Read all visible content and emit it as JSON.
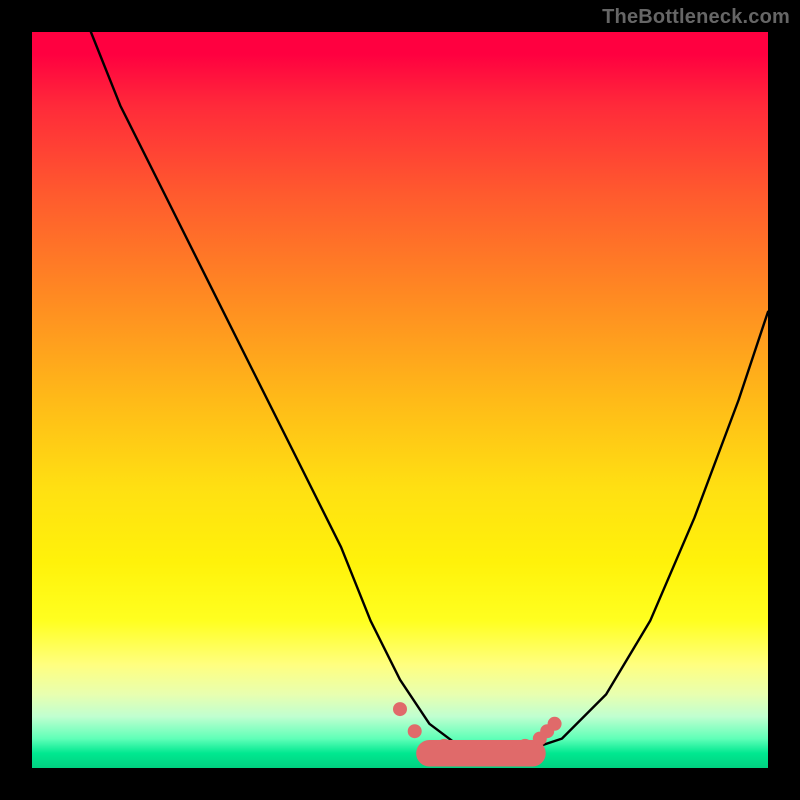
{
  "watermark": "TheBottleneck.com",
  "chart_data": {
    "type": "line",
    "title": "",
    "xlabel": "",
    "ylabel": "",
    "xlim": [
      0,
      100
    ],
    "ylim": [
      0,
      100
    ],
    "series": [
      {
        "name": "bottleneck-curve",
        "x": [
          8,
          12,
          18,
          24,
          30,
          36,
          42,
          46,
          50,
          54,
          58,
          62,
          66,
          72,
          78,
          84,
          90,
          96,
          100
        ],
        "values": [
          100,
          90,
          78,
          66,
          54,
          42,
          30,
          20,
          12,
          6,
          3,
          2,
          2,
          4,
          10,
          20,
          34,
          50,
          62
        ]
      }
    ],
    "markers": {
      "name": "highlight-dots",
      "color": "#e06a6a",
      "x": [
        50,
        52,
        56,
        59,
        62,
        65,
        67,
        69,
        70,
        71
      ],
      "values": [
        8,
        5,
        3,
        2,
        2,
        2,
        3,
        4,
        5,
        6
      ]
    },
    "marker_bar": {
      "name": "highlight-bar",
      "color": "#e06a6a",
      "x_start": 54,
      "x_end": 68,
      "y": 2,
      "thickness": 3
    },
    "background_gradient": {
      "top": "#ff0040",
      "mid": "#ffe012",
      "bottom": "#00d080"
    }
  }
}
